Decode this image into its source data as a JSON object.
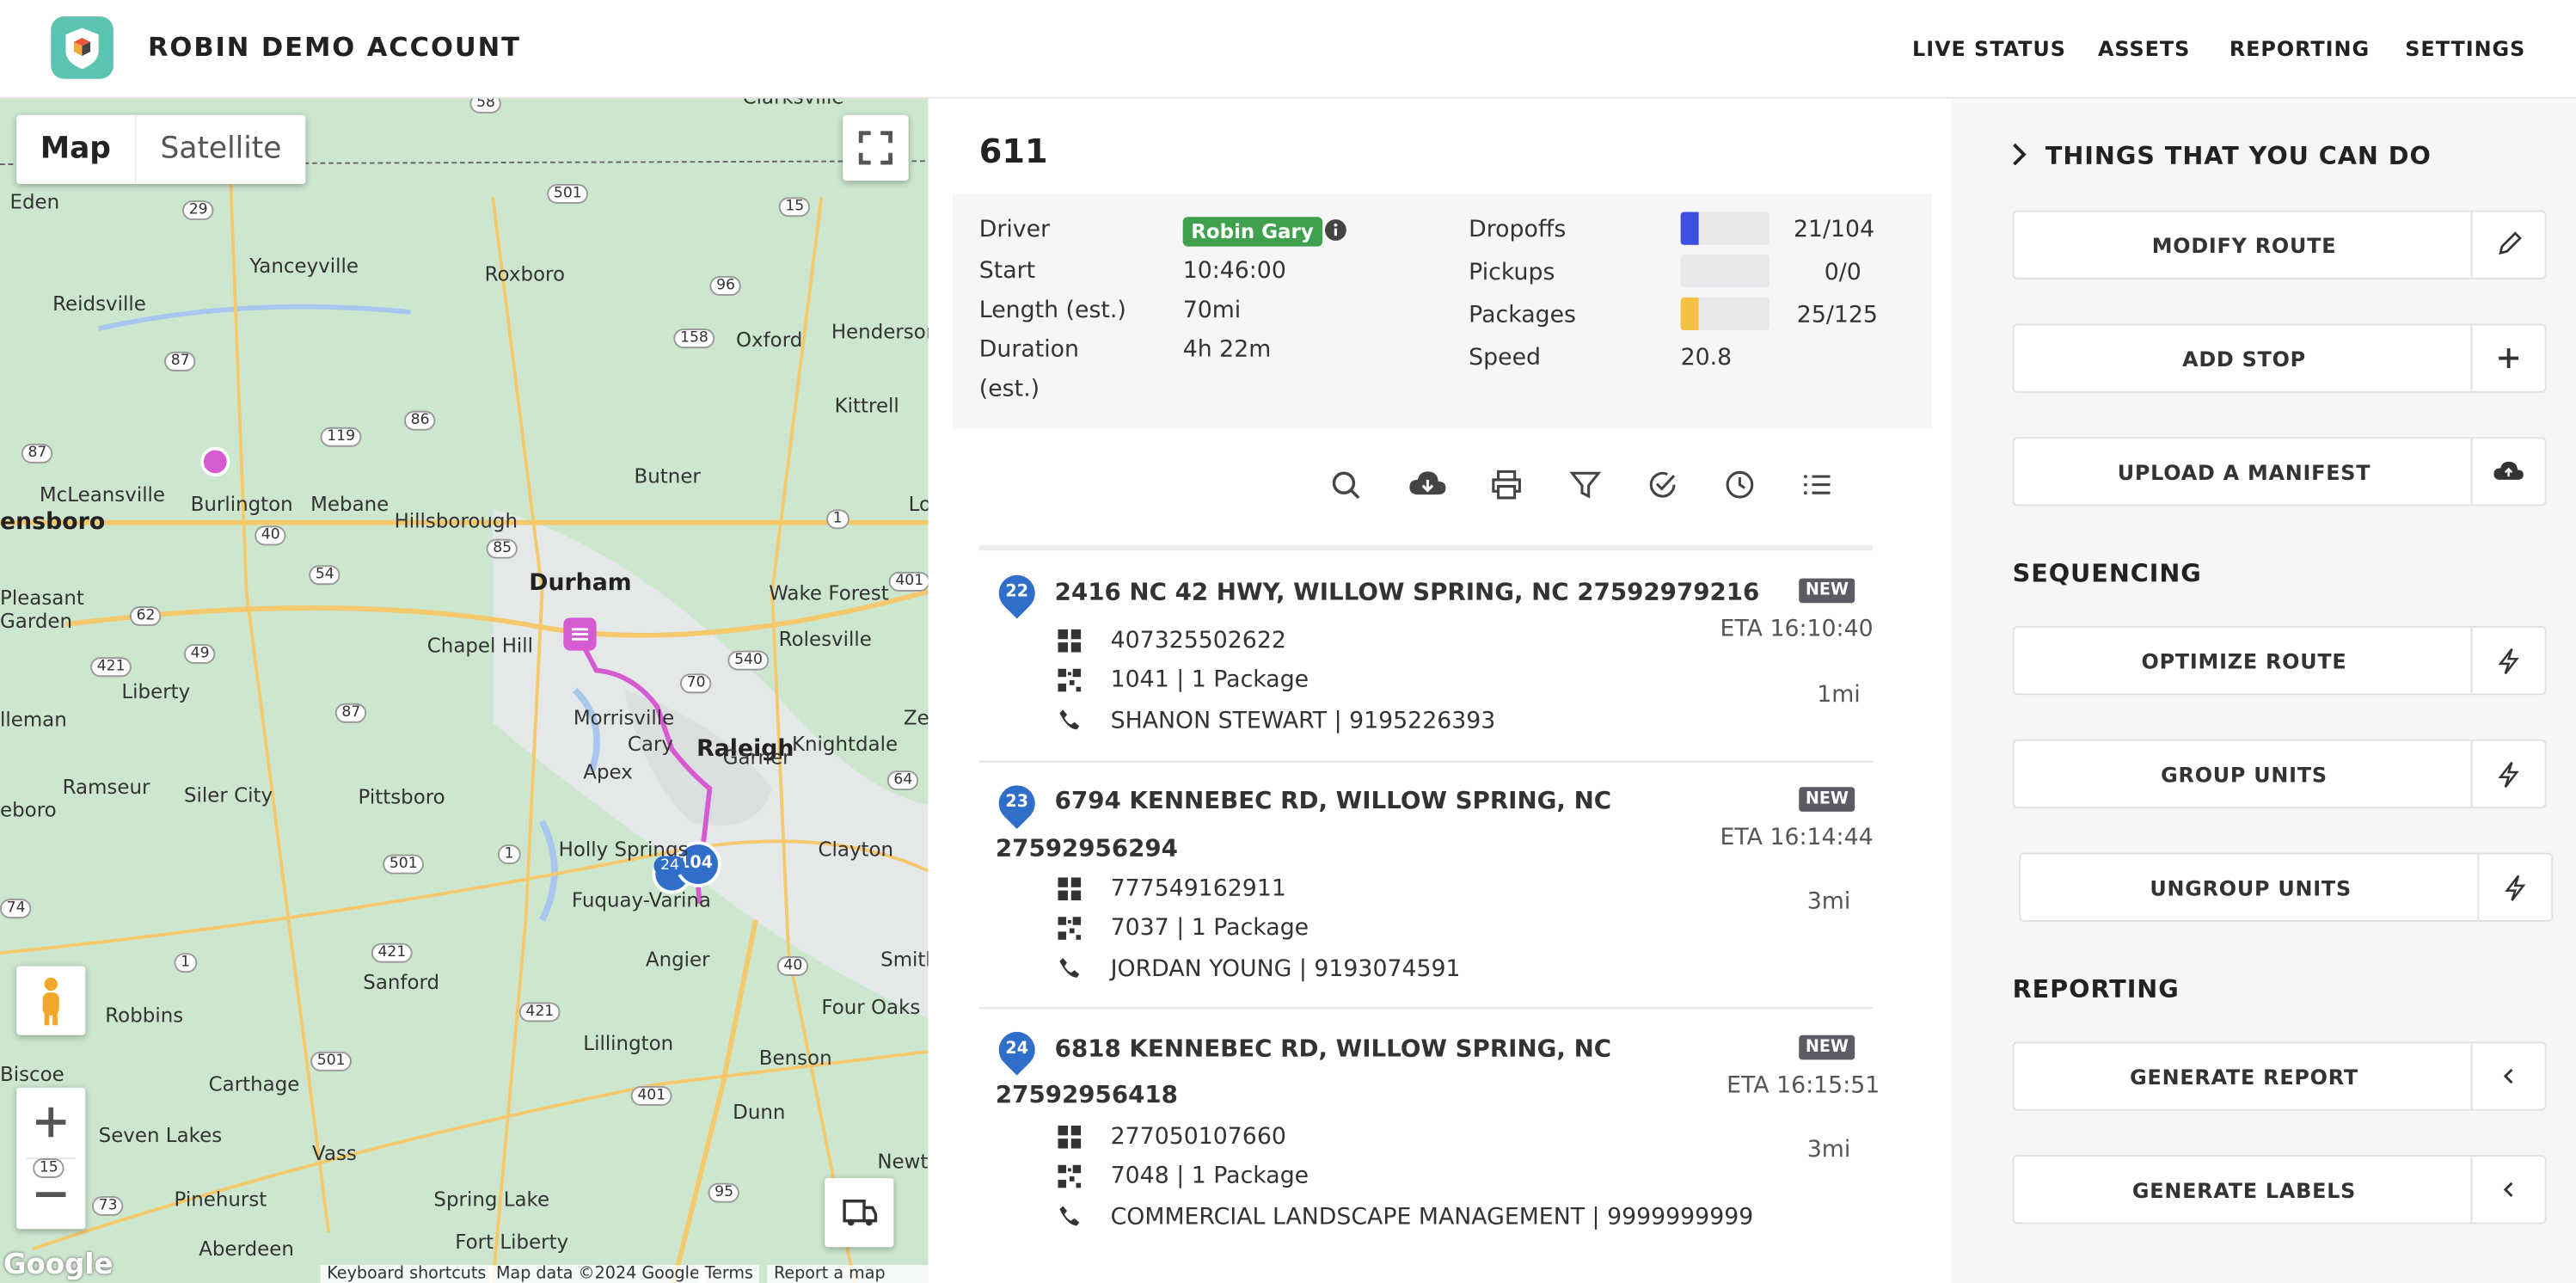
{
  "header": {
    "brand": "ROBIN DEMO ACCOUNT",
    "nav": [
      {
        "label": "LIVE STATUS"
      },
      {
        "label": "ASSETS"
      },
      {
        "label": "REPORTING"
      },
      {
        "label": "SETTINGS"
      }
    ]
  },
  "map": {
    "type_map": "Map",
    "type_satellite": "Satellite",
    "cities": [
      "Eden",
      "Yanceyville",
      "Roxboro",
      "Reidsville",
      "Oxford",
      "Henderson",
      "Kittrell",
      "Butner",
      "McLeansville",
      "Burlington",
      "Mebane",
      "Hillsborough",
      "Durham",
      "Wake Forest",
      "Rolesville",
      "Chapel Hill",
      "Morrisville",
      "Cary",
      "Raleigh",
      "Knightdale",
      "Liberty",
      "Ramseur",
      "Siler City",
      "Pittsboro",
      "Apex",
      "Garner",
      "Holly Springs",
      "Fuquay-Varina",
      "Clayton",
      "Angier",
      "Sanford",
      "Smith",
      "Four Oaks",
      "Robbins",
      "Lillington",
      "Benson",
      "Carthage",
      "Seven Lakes",
      "Dunn",
      "Vass",
      "Newton",
      "Pinehurst",
      "Spring Lake",
      "Fort Liberty",
      "Aberdeen",
      "Pleasant Garden",
      "ensboro",
      "Biscoe",
      "lleman",
      "eboro",
      "Lo",
      "Ze",
      "Clarksville"
    ],
    "routes": [
      "58",
      "29",
      "501",
      "15",
      "87",
      "96",
      "158",
      "119",
      "86",
      "1",
      "85",
      "40",
      "54",
      "62",
      "49",
      "70",
      "540",
      "401",
      "421",
      "87",
      "64",
      "501",
      "1",
      "421",
      "40",
      "421",
      "1",
      "501",
      "401",
      "95",
      "15",
      "73",
      "74",
      "24",
      "87"
    ],
    "attribution": [
      "Keyboard shortcuts",
      "Map data ©2024 Google",
      "Terms",
      "Report a map error"
    ],
    "google": "Google",
    "cluster_label": "104"
  },
  "route": {
    "name": "611",
    "driver_label": "Driver",
    "driver": "Robin Gary",
    "start_label": "Start",
    "start": "10:46:00",
    "length_label": "Length (est.)",
    "length": "70mi",
    "duration_label": "Duration (est.)",
    "duration": "4h 22m",
    "dropoffs_label": "Dropoffs",
    "dropoffs": "21/104",
    "dropoffs_progress": 0.2019,
    "pickups_label": "Pickups",
    "pickups": "0/0",
    "pickups_progress": 0,
    "packages_label": "Packages",
    "packages": "25/125",
    "packages_progress": 0.2,
    "speed_label": "Speed",
    "speed": "20.8",
    "colors": {
      "dropoffs": "#3b4fe0",
      "packages": "#f4c243",
      "driver_badge": "#3fa14d"
    }
  },
  "toolbar": [
    "search-icon",
    "cloud-download-icon",
    "print-icon",
    "filter-icon",
    "check-circle-icon",
    "clock-icon",
    "list-icon"
  ],
  "stops": [
    {
      "seq": "22",
      "address": "2416 NC 42 HWY, WILLOW SPRING, NC 27592979216",
      "address2": "",
      "status": "NEW",
      "eta": "ETA 16:10:40",
      "distance": "1mi",
      "barcode": "407325502622",
      "units": "1041 | 1 Package",
      "contact": "SHANON STEWART | 9195226393"
    },
    {
      "seq": "23",
      "address": "6794 KENNEBEC RD, WILLOW SPRING, NC",
      "address2": "27592956294",
      "status": "NEW",
      "eta": "ETA 16:14:44",
      "distance": "3mi",
      "barcode": "777549162911",
      "units": "7037 | 1 Package",
      "contact": "JORDAN YOUNG | 9193074591"
    },
    {
      "seq": "24",
      "address": "6818 KENNEBEC RD, WILLOW SPRING, NC",
      "address2": "27592956418",
      "status": "NEW",
      "eta": "ETA 16:15:51",
      "distance": "3mi",
      "barcode": "277050107660",
      "units": "7048 | 1 Package",
      "contact": "COMMERCIAL LANDSCAPE MANAGEMENT | 9999999999"
    }
  ],
  "side": {
    "things_heading": "THINGS THAT YOU CAN DO",
    "modify_route": "MODIFY ROUTE",
    "add_stop": "ADD STOP",
    "upload_manifest": "UPLOAD A MANIFEST",
    "sequencing_heading": "SEQUENCING",
    "optimize_route": "OPTIMIZE ROUTE",
    "group_units": "GROUP UNITS",
    "ungroup_units": "UNGROUP UNITS",
    "reporting_heading": "REPORTING",
    "generate_report": "GENERATE REPORT",
    "generate_labels": "GENERATE LABELS"
  }
}
